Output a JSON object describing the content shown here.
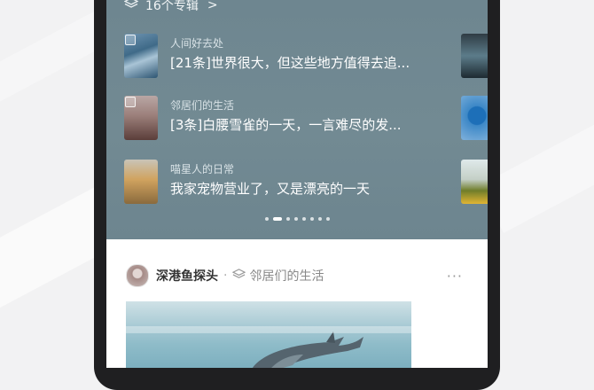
{
  "albums_header": {
    "count_label": "16个专辑",
    "chevron": ">"
  },
  "albums": [
    {
      "title": "人间好去处",
      "description": "[21条]世界很大，但这些地方值得去追..."
    },
    {
      "title": "邻居们的生活",
      "description": "[3条]白腰雪雀的一天，一言难尽的发..."
    },
    {
      "title": "喵星人的日常",
      "description": "我家宠物营业了，又是漂亮的一天"
    }
  ],
  "pager": {
    "total": 8,
    "active_index": 1
  },
  "post": {
    "author": "深港鱼探头",
    "separator": "·",
    "album": "邻居们的生活",
    "more": "···"
  },
  "colors": {
    "panel": "#728a93",
    "phone_frame": "#1f1f21",
    "background": "#f2f2f3"
  }
}
